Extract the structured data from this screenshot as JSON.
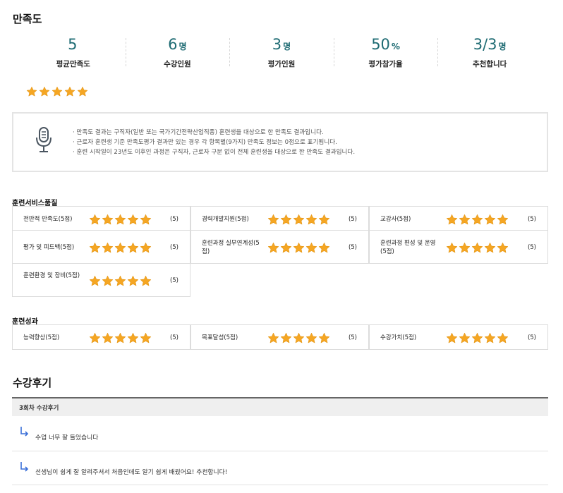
{
  "satisfaction": {
    "title": "만족도",
    "stats": [
      {
        "value": "5",
        "unit": "",
        "label": "평균만족도"
      },
      {
        "value": "6",
        "unit": "명",
        "label": "수강인원"
      },
      {
        "value": "3",
        "unit": "명",
        "label": "평가인원"
      },
      {
        "value": "50",
        "unit": "%",
        "label": "평가참가율"
      },
      {
        "value": "3/3",
        "unit": "명",
        "label": "추천합니다"
      }
    ],
    "overall_rating": 5,
    "notice_items": [
      "· 만족도 결과는 구직자(일반 또는 국가기간전략산업직종) 훈련생을 대상으로 한 만족도 결과입니다.",
      "· 근로자 훈련생 기준 만족도평가 결과만 있는 경우 각 항목별(9가지) 만족도 정보는 0점으로 표기됩니다.",
      "· 훈련 시작일이 23년도 이후인 과정은 구직자, 근로자 구분 없이 전체 훈련생을 대상으로 한 만족도 결과입니다."
    ]
  },
  "service_quality": {
    "title": "훈련서비스품질",
    "items": [
      {
        "label": "전반적 만족도(5점)",
        "rating": 5,
        "score": "(5)"
      },
      {
        "label": "경력개발지원(5점)",
        "rating": 5,
        "score": "(5)"
      },
      {
        "label": "교강사(5점)",
        "rating": 5,
        "score": "(5)"
      },
      {
        "label": "평가 및 피드백(5점)",
        "rating": 5,
        "score": "(5)"
      },
      {
        "label": "훈련과정 실무연계성(5점)",
        "rating": 5,
        "score": "(5)"
      },
      {
        "label": "훈련과정 편성 및 운영(5점)",
        "rating": 5,
        "score": "(5)"
      },
      {
        "label": "훈련환경 및 장비(5점)",
        "rating": 5,
        "score": "(5)"
      }
    ]
  },
  "outcomes": {
    "title": "훈련성과",
    "items": [
      {
        "label": "능력향상(5점)",
        "rating": 5,
        "score": "(5)"
      },
      {
        "label": "목표달성(5점)",
        "rating": 5,
        "score": "(5)"
      },
      {
        "label": "수강가치(5점)",
        "rating": 5,
        "score": "(5)"
      }
    ]
  },
  "reviews": {
    "title": "수강후기",
    "round_label": "3회차 수강후기",
    "items": [
      "수업 너무 잘 들었습니다",
      "선생님이 쉽게 잘 알려주셔서 처음인데도 알기 쉽게 배웠어요! 추천합니다!"
    ]
  },
  "colors": {
    "accent": "#1e6b73",
    "star": "#f5a623",
    "review_arrow": "#3a6fd8"
  }
}
